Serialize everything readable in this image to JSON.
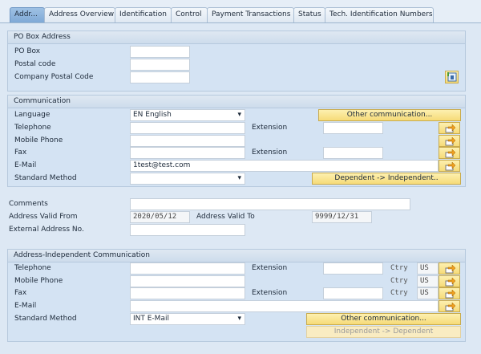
{
  "tabs": [
    "Addr...",
    "Address Overview",
    "Identification",
    "Control",
    "Payment Transactions",
    "Status",
    "Tech. Identification Numbers"
  ],
  "po_box": {
    "title": "PO Box Address",
    "po_box": "PO Box",
    "postal_code": "Postal code",
    "company_postal_code": "Company Postal Code"
  },
  "communication": {
    "title": "Communication",
    "language": "Language",
    "language_value": "EN English",
    "telephone": "Telephone",
    "extension": "Extension",
    "mobile": "Mobile Phone",
    "fax": "Fax",
    "email": "E-Mail",
    "email_value": "1test@test.com",
    "standard_method": "Standard Method",
    "other_btn": "Other communication...",
    "dep_btn": "Dependent -> Independent.."
  },
  "general": {
    "comments": "Comments",
    "valid_from": "Address Valid From",
    "valid_from_value": "2020/05/12",
    "valid_to": "Address Valid To",
    "valid_to_value": "9999/12/31",
    "external_no": "External Address No."
  },
  "independent": {
    "title": "Address-Independent Communication",
    "telephone": "Telephone",
    "extension": "Extension",
    "mobile": "Mobile Phone",
    "fax": "Fax",
    "email": "E-Mail",
    "standard_method": "Standard Method",
    "method_value": "INT E-Mail",
    "ctry": "Ctry",
    "ctry_value": "US",
    "other_btn": "Other communication...",
    "indep_btn": "Independent -> Dependent"
  }
}
